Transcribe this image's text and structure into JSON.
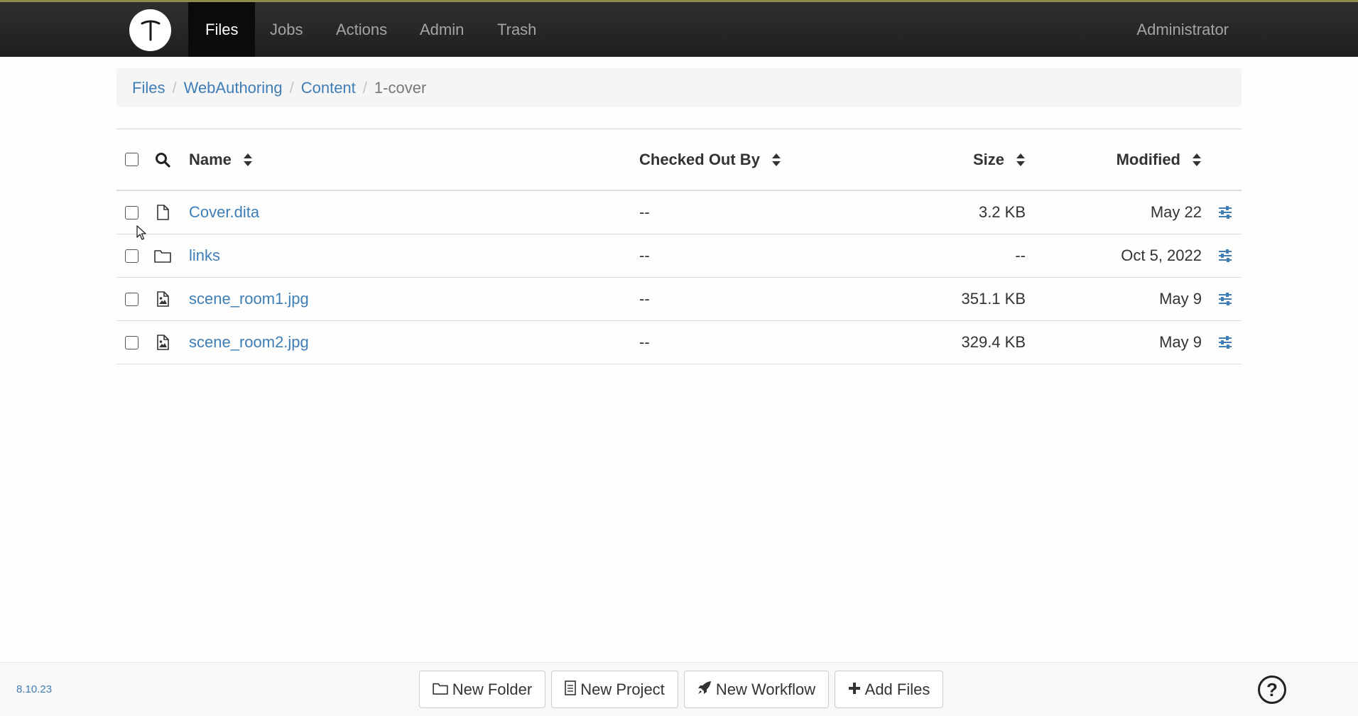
{
  "navbar": {
    "logo_icon": "t-logo-icon",
    "items": [
      {
        "label": "Files",
        "active": true
      },
      {
        "label": "Jobs",
        "active": false
      },
      {
        "label": "Actions",
        "active": false
      },
      {
        "label": "Admin",
        "active": false
      },
      {
        "label": "Trash",
        "active": false
      }
    ],
    "user": "Administrator"
  },
  "breadcrumb": {
    "links": [
      "Files",
      "WebAuthoring",
      "Content"
    ],
    "current": "1-cover",
    "separator": "/"
  },
  "table": {
    "columns": {
      "name": "Name",
      "checked_out_by": "Checked Out By",
      "size": "Size",
      "modified": "Modified"
    },
    "rows": [
      {
        "icon": "file-icon",
        "name": "Cover.dita",
        "checked_out_by": "--",
        "size": "3.2 KB",
        "modified": "May 22"
      },
      {
        "icon": "folder-icon",
        "name": "links",
        "checked_out_by": "--",
        "size": "--",
        "modified": "Oct 5, 2022"
      },
      {
        "icon": "image-file-icon",
        "name": "scene_room1.jpg",
        "checked_out_by": "--",
        "size": "351.1 KB",
        "modified": "May 9"
      },
      {
        "icon": "image-file-icon",
        "name": "scene_room2.jpg",
        "checked_out_by": "--",
        "size": "329.4 KB",
        "modified": "May 9"
      }
    ]
  },
  "footer": {
    "version": "8.10.23",
    "buttons": {
      "new_folder": "New Folder",
      "new_project": "New Project",
      "new_workflow": "New Workflow",
      "add_files": "Add Files"
    },
    "help": "?"
  },
  "colors": {
    "link": "#3e7db5",
    "navbar": "#2a2a2a",
    "nav_active": "#0b0b0b"
  }
}
